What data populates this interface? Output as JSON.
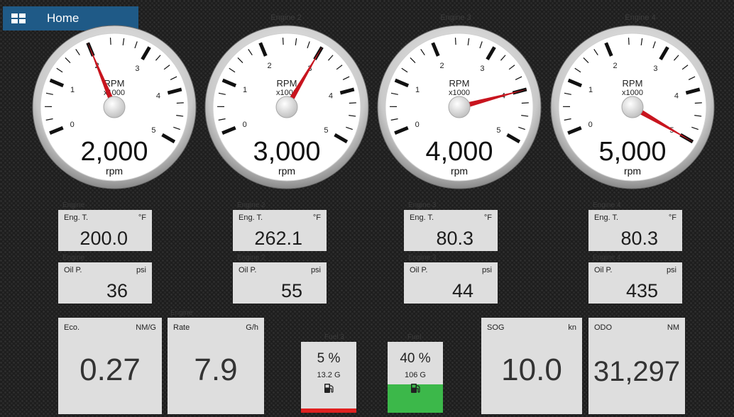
{
  "header": {
    "home_label": "Home"
  },
  "engine_titles": [
    "Engine 2",
    "Engine 3",
    "Engine 4"
  ],
  "gauges": [
    {
      "value": 2000,
      "display": "2,000",
      "unit": "rpm",
      "label": "RPM",
      "multiplier": "x1000",
      "ticks": [
        "0",
        "1",
        "2",
        "3",
        "4",
        "5"
      ]
    },
    {
      "value": 3000,
      "display": "3,000",
      "unit": "rpm",
      "label": "RPM",
      "multiplier": "x1000",
      "ticks": [
        "0",
        "1",
        "2",
        "3",
        "4",
        "5"
      ]
    },
    {
      "value": 4000,
      "display": "4,000",
      "unit": "rpm",
      "label": "RPM",
      "multiplier": "x1000",
      "ticks": [
        "0",
        "1",
        "2",
        "3",
        "4",
        "5"
      ]
    },
    {
      "value": 5000,
      "display": "5,000",
      "unit": "rpm",
      "label": "RPM",
      "multiplier": "x1000",
      "ticks": [
        "0",
        "1",
        "2",
        "3",
        "4",
        "5"
      ]
    }
  ],
  "temp_tiles": [
    {
      "caption": "Engine",
      "name": "Eng. T.",
      "unit": "°F",
      "value": "200.0"
    },
    {
      "caption": "Engine 2",
      "name": "Eng. T.",
      "unit": "°F",
      "value": "262.1"
    },
    {
      "caption": "Engine 3",
      "name": "Eng. T.",
      "unit": "°F",
      "value": "80.3"
    },
    {
      "caption": "Engine 4",
      "name": "Eng. T.",
      "unit": "°F",
      "value": "80.3"
    }
  ],
  "oil_tiles": [
    {
      "caption": "Engine",
      "name": "Oil P.",
      "unit": "psi",
      "value": "36"
    },
    {
      "caption": "Engine 2",
      "name": "Oil P.",
      "unit": "psi",
      "value": "55"
    },
    {
      "caption": "Engine 3",
      "name": "Oil P.",
      "unit": "psi",
      "value": "44"
    },
    {
      "caption": "Engine 4",
      "name": "Oil P.",
      "unit": "psi",
      "value": "435"
    }
  ],
  "bottom": {
    "eco": {
      "name": "Eco.",
      "unit": "NM/G",
      "value": "0.27"
    },
    "rate": {
      "caption": "Engine",
      "name": "Rate",
      "unit": "G/h",
      "value": "7.9"
    },
    "fuel1": {
      "caption": "Fuel 3",
      "percent": "5 %",
      "gallons": "13.2 G",
      "level": 0.05,
      "bar_color": "#e02020"
    },
    "fuel2": {
      "caption": "Fuel",
      "percent": "40 %",
      "gallons": "106 G",
      "level": 0.4,
      "bar_color": "#3cb84a"
    },
    "sog": {
      "name": "SOG",
      "unit": "kn",
      "value": "10.0"
    },
    "odo": {
      "name": "ODO",
      "unit": "NM",
      "value": "31,297"
    }
  },
  "colors": {
    "accent": "#1f5a87",
    "needle": "#c8141e",
    "tile": "#dedede"
  }
}
